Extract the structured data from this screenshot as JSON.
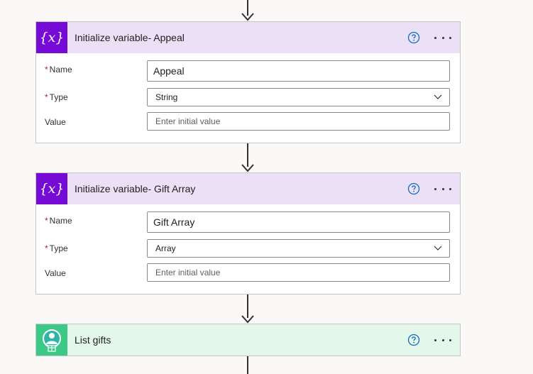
{
  "accent": {
    "variable_header_bg": "#ece0f7",
    "variable_icon_bg": "#770bd6",
    "list_header_bg": "#e3f7ea",
    "list_icon_bg": "#3cc987",
    "help_icon_color": "#0f6cbd"
  },
  "cards": [
    {
      "title": "Initialize variable- Appeal",
      "icon": "variable-icon",
      "icon_glyph": "{x}",
      "fields": {
        "name_label": "Name",
        "name_value": "Appeal",
        "type_label": "Type",
        "type_value": "String",
        "value_label": "Value",
        "value_placeholder": "Enter initial value"
      }
    },
    {
      "title": "Initialize variable- Gift Array",
      "icon": "variable-icon",
      "icon_glyph": "{x}",
      "fields": {
        "name_label": "Name",
        "name_value": "Gift Array",
        "type_label": "Type",
        "type_value": "Array",
        "value_label": "Value",
        "value_placeholder": "Enter initial value"
      }
    },
    {
      "title": "List gifts",
      "icon": "gift-connector-icon"
    }
  ],
  "required_marker": "*"
}
